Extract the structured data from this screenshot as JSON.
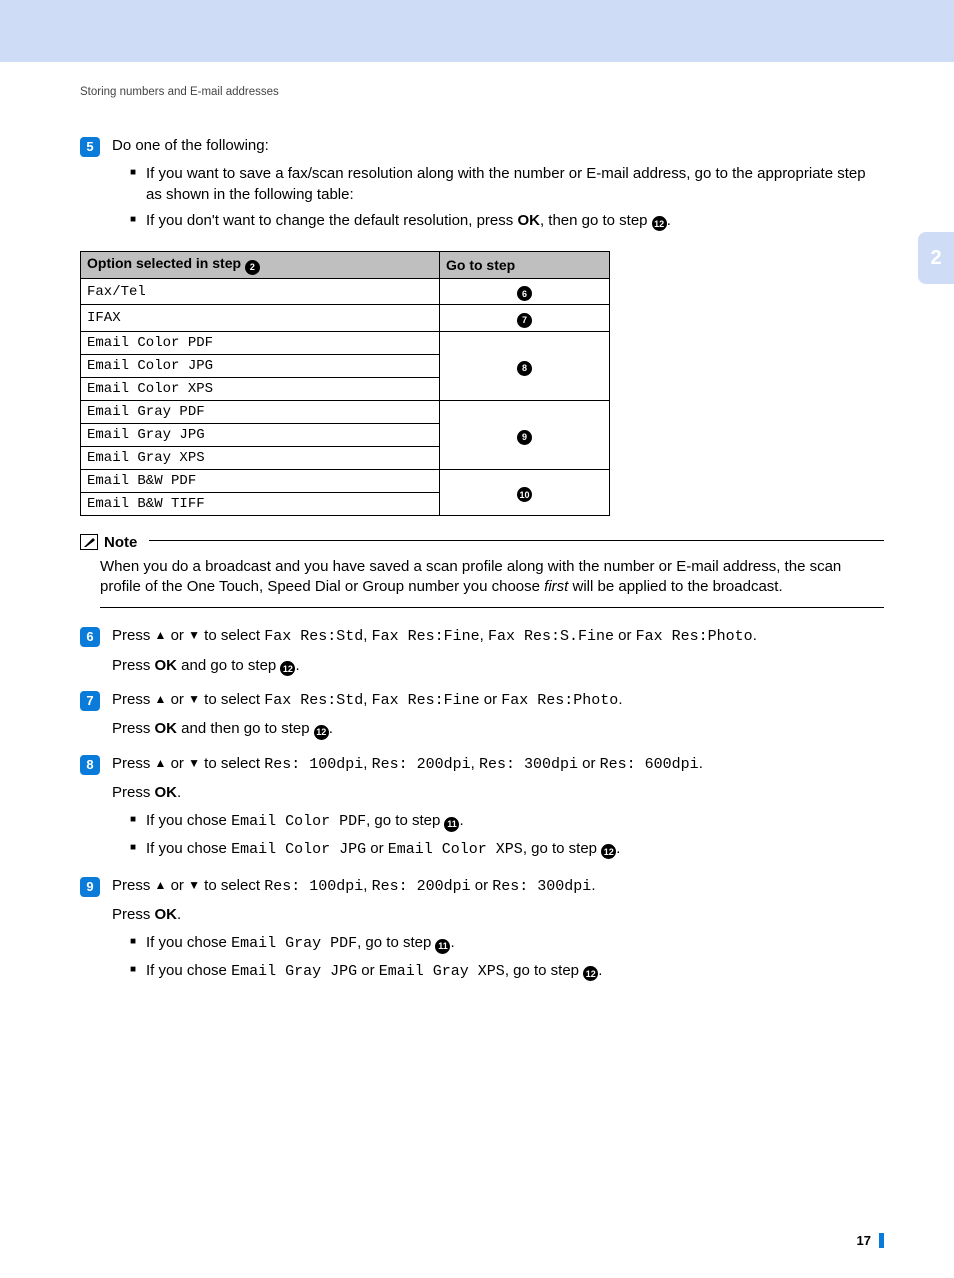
{
  "breadcrumb": "Storing numbers and E-mail addresses",
  "sideTab": "2",
  "step5": {
    "num": "5",
    "text": "Do one of the following:",
    "bullet1a": "If you want to save a fax/scan resolution along with the number or E-mail address, go to the appropriate step as shown in the following table:",
    "bullet1b_pre": "If you don't want to change the default resolution, press ",
    "bullet1b_ok": "OK",
    "bullet1b_mid": ", then go to step ",
    "bullet1b_ref": "12",
    "bullet1b_end": "."
  },
  "table": {
    "h1_pre": "Option selected in step ",
    "h1_ref": "2",
    "h2": "Go to step",
    "r1": {
      "opt": "Fax/Tel",
      "ref": "6"
    },
    "r2": {
      "opt": "IFAX",
      "ref": "7"
    },
    "r3a": "Email Color PDF",
    "r3b": "Email Color JPG",
    "r3c": "Email Color XPS",
    "r3ref": "8",
    "r4a": "Email Gray PDF",
    "r4b": "Email Gray JPG",
    "r4c": "Email Gray XPS",
    "r4ref": "9",
    "r5a": "Email B&W PDF",
    "r5b": "Email B&W TIFF",
    "r5ref": "10"
  },
  "note": {
    "label": "Note",
    "body_pre": "When you do a broadcast and you have saved a scan profile along with the number or E-mail address, the scan profile of the One Touch, Speed Dial or Group number you choose ",
    "body_ital": "first",
    "body_post": " will be applied to the broadcast."
  },
  "step6": {
    "num": "6",
    "pre": "Press ",
    "mid1": " or ",
    "mid2": " to select ",
    "o1": "Fax Res:Std",
    "s1": ", ",
    "o2": "Fax Res:Fine",
    "s2": ", ",
    "o3": "Fax Res:S.Fine",
    "s3": " or ",
    "o4": "Fax Res:Photo",
    "end1": ".",
    "line2_pre": "Press ",
    "line2_ok": "OK",
    "line2_mid": " and go to step ",
    "line2_ref": "12",
    "line2_end": "."
  },
  "step7": {
    "num": "7",
    "pre": "Press ",
    "mid1": " or ",
    "mid2": " to select ",
    "o1": "Fax Res:Std",
    "s1": ", ",
    "o2": "Fax Res:Fine",
    "s2": " or ",
    "o3": "Fax Res:Photo",
    "end1": ".",
    "line2_pre": "Press ",
    "line2_ok": "OK",
    "line2_mid": " and then go to step ",
    "line2_ref": "12",
    "line2_end": "."
  },
  "step8": {
    "num": "8",
    "pre": "Press ",
    "mid1": " or ",
    "mid2": " to select ",
    "o1": "Res: 100dpi",
    "s1": ", ",
    "o2": "Res: 200dpi",
    "s2": ", ",
    "o3": "Res: 300dpi",
    "s3": " or ",
    "o4": "Res: 600dpi",
    "end1": ".",
    "line2_pre": "Press ",
    "line2_ok": "OK",
    "line2_end": ".",
    "b1_pre": "If you chose ",
    "b1_code": "Email Color PDF",
    "b1_mid": ", go to step ",
    "b1_ref": "11",
    "b1_end": ".",
    "b2_pre": "If you chose ",
    "b2_code1": "Email Color JPG",
    "b2_or": " or ",
    "b2_code2": "Email Color XPS",
    "b2_mid": ", go to step ",
    "b2_ref": "12",
    "b2_end": "."
  },
  "step9": {
    "num": "9",
    "pre": "Press ",
    "mid1": " or ",
    "mid2": " to select ",
    "o1": "Res: 100dpi",
    "s1": ", ",
    "o2": "Res: 200dpi",
    "s2": " or ",
    "o3": "Res: 300dpi",
    "end1": ".",
    "line2_pre": "Press ",
    "line2_ok": "OK",
    "line2_end": ".",
    "b1_pre": "If you chose ",
    "b1_code": "Email Gray PDF",
    "b1_mid": ", go to step ",
    "b1_ref": "11",
    "b1_end": ".",
    "b2_pre": "If you chose ",
    "b2_code1": "Email Gray JPG",
    "b2_or": " or ",
    "b2_code2": "Email Gray XPS",
    "b2_mid": ", go to step ",
    "b2_ref": "12",
    "b2_end": "."
  },
  "pageNum": "17"
}
